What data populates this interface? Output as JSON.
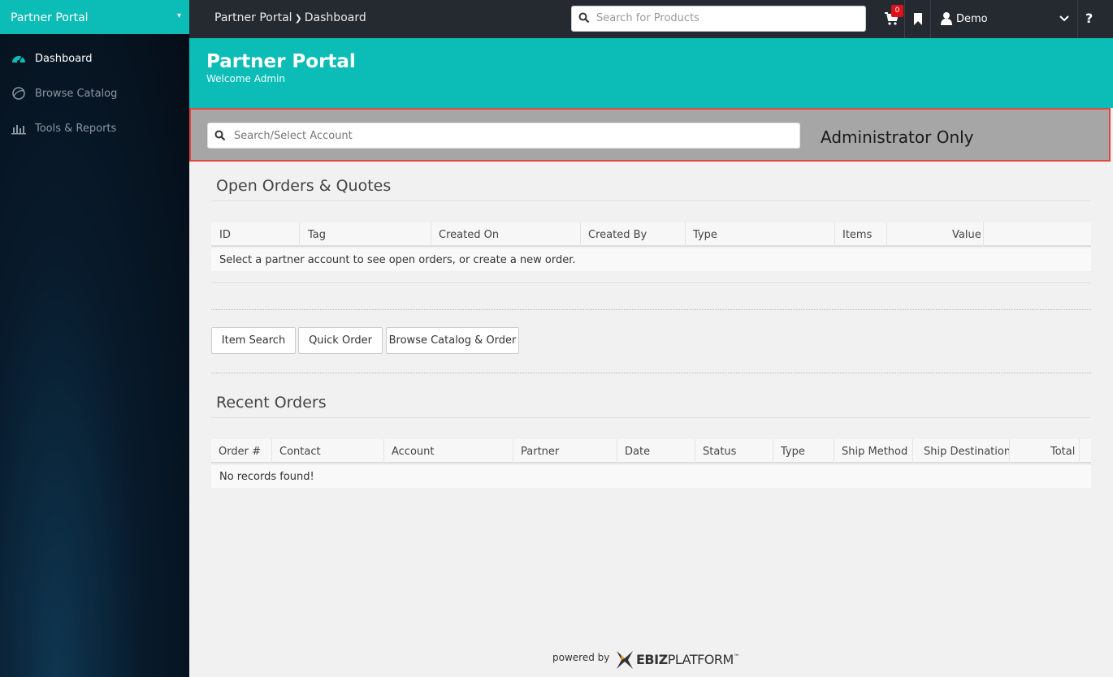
{
  "sidebar": {
    "brand": "Partner Portal",
    "items": [
      {
        "label": "Dashboard"
      },
      {
        "label": "Browse Catalog"
      },
      {
        "label": "Tools & Reports"
      }
    ]
  },
  "topbar": {
    "breadcrumb_root": "Partner Portal",
    "breadcrumb_current": "Dashboard",
    "search_placeholder": "Search for Products",
    "cart_count": "0",
    "user_name": "Demo",
    "help": "?"
  },
  "hero": {
    "title": "Partner Portal",
    "subtitle": "Welcome Admin"
  },
  "admin": {
    "search_placeholder": "Search/Select Account",
    "label": "Administrator Only"
  },
  "open_orders": {
    "title": "Open Orders & Quotes",
    "columns": [
      "ID",
      "Tag",
      "Created On",
      "Created By",
      "Type",
      "Items",
      "Value"
    ],
    "empty_message": "Select a partner account to see open orders, or create a new order."
  },
  "actions": {
    "item_search": "Item Search",
    "quick_order": "Quick Order",
    "browse_order": "Browse Catalog & Order"
  },
  "recent_orders": {
    "title": "Recent Orders",
    "columns": [
      "Order #",
      "Contact",
      "Account",
      "Partner",
      "Date",
      "Status",
      "Type",
      "Ship Method",
      "Ship Destination",
      "Total"
    ],
    "empty_message": "No records found!"
  },
  "footer": {
    "powered_by": "powered by",
    "logo_bold": "EBIZ",
    "logo_rest": "PLATFORM",
    "tm": "™"
  },
  "colors": {
    "accent": "#0bbdb6",
    "topbar": "#252a30",
    "badge": "#e0101a",
    "admin_border": "#e8453c"
  }
}
